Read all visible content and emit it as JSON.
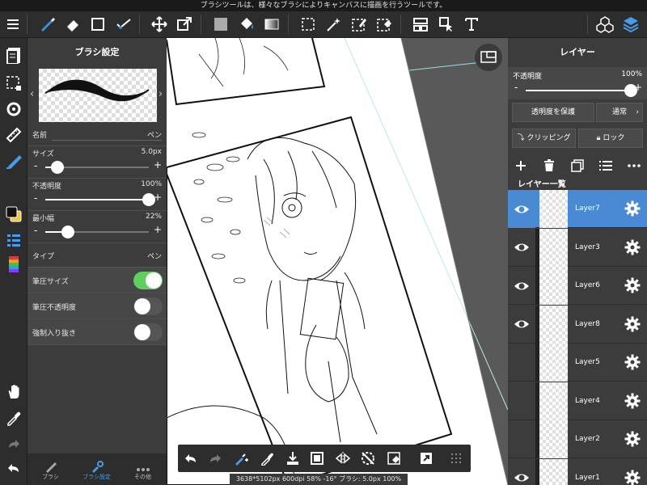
{
  "hint": "ブラシツールは、様々なブラシによりキャンバスに描画を行うツールです。",
  "brush_panel": {
    "title": "ブラシ設定",
    "name_label": "名前",
    "name_value": "ペン",
    "size_label": "サイズ",
    "size_value": "5.0px",
    "size_level": 0.12,
    "opacity_label": "不透明度",
    "opacity_value": "100%",
    "opacity_level": 1.0,
    "minwidth_label": "最小幅",
    "minwidth_value": "22%",
    "minwidth_level": 0.22,
    "type_label": "タイプ",
    "type_value": "ペン",
    "pressure_size_label": "筆圧サイズ",
    "pressure_size_on": true,
    "pressure_opacity_label": "筆圧不透明度",
    "pressure_opacity_on": false,
    "taper_label": "強制入り抜き",
    "taper_on": false,
    "minus": "-",
    "plus": "+",
    "tabs": [
      {
        "label": "ブラシ",
        "icon": "brush-icon"
      },
      {
        "label": "ブラシ設定",
        "icon": "brush-settings-icon"
      },
      {
        "label": "その他",
        "icon": "more-icon"
      }
    ]
  },
  "status_text": "3638*5102px 600dpi 58% -16° ブラシ: 5.0px 100%",
  "layer_panel": {
    "title": "レイヤー",
    "opacity_label": "不透明度",
    "opacity_value": "100%",
    "opacity_level": 1.0,
    "minus": "-",
    "plus": "+",
    "protect_alpha": "透明度を保護",
    "blend_mode": "通常",
    "clipping": "クリッピング",
    "lock": "ロック",
    "list_label": "レイヤー一覧",
    "layers": [
      {
        "name": "Layer7",
        "selected": true,
        "visible": true
      },
      {
        "name": "Layer3",
        "selected": false,
        "visible": true
      },
      {
        "name": "Layer6",
        "selected": false,
        "visible": true
      },
      {
        "name": "Layer8",
        "selected": false,
        "visible": true
      },
      {
        "name": "Layer5",
        "selected": false,
        "visible": false
      },
      {
        "name": "Layer4",
        "selected": false,
        "visible": false
      },
      {
        "name": "Layer2",
        "selected": false,
        "visible": false
      },
      {
        "name": "Layer1",
        "selected": false,
        "visible": true
      }
    ]
  },
  "colors": {
    "accent": "#4a8ad4",
    "toggle_on": "#5fcf5f",
    "panel_bg": "#3c3c3c",
    "toolbar_bg": "#2d2d2d",
    "primary_color": "#111111",
    "secondary_color": "#f5c542"
  }
}
